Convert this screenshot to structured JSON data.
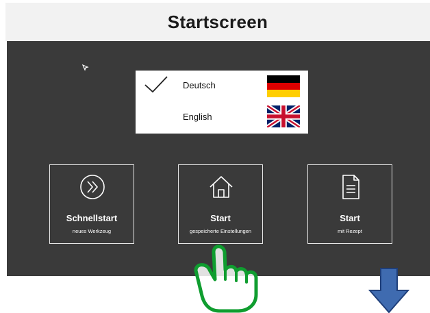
{
  "header": {
    "title": "Startscreen"
  },
  "language": {
    "options": [
      {
        "label": "Deutsch",
        "selected": true,
        "flag": "germany-flag-icon"
      },
      {
        "label": "English",
        "selected": false,
        "flag": "uk-flag-icon"
      }
    ]
  },
  "tiles": [
    {
      "title": "Schnellstart",
      "subtitle": "neues Werkzeug",
      "icon": "double-chevron-right-icon"
    },
    {
      "title": "Start",
      "subtitle": "gespeicherte Einstellungen",
      "icon": "home-icon"
    },
    {
      "title": "Start",
      "subtitle": "mit Rezept",
      "icon": "document-icon"
    }
  ],
  "colors": {
    "panel": "#3a3a3a",
    "title_bar": "#f2f2f2",
    "hand_outline": "#0f9d2f",
    "arrow": "#3f6bb0"
  }
}
